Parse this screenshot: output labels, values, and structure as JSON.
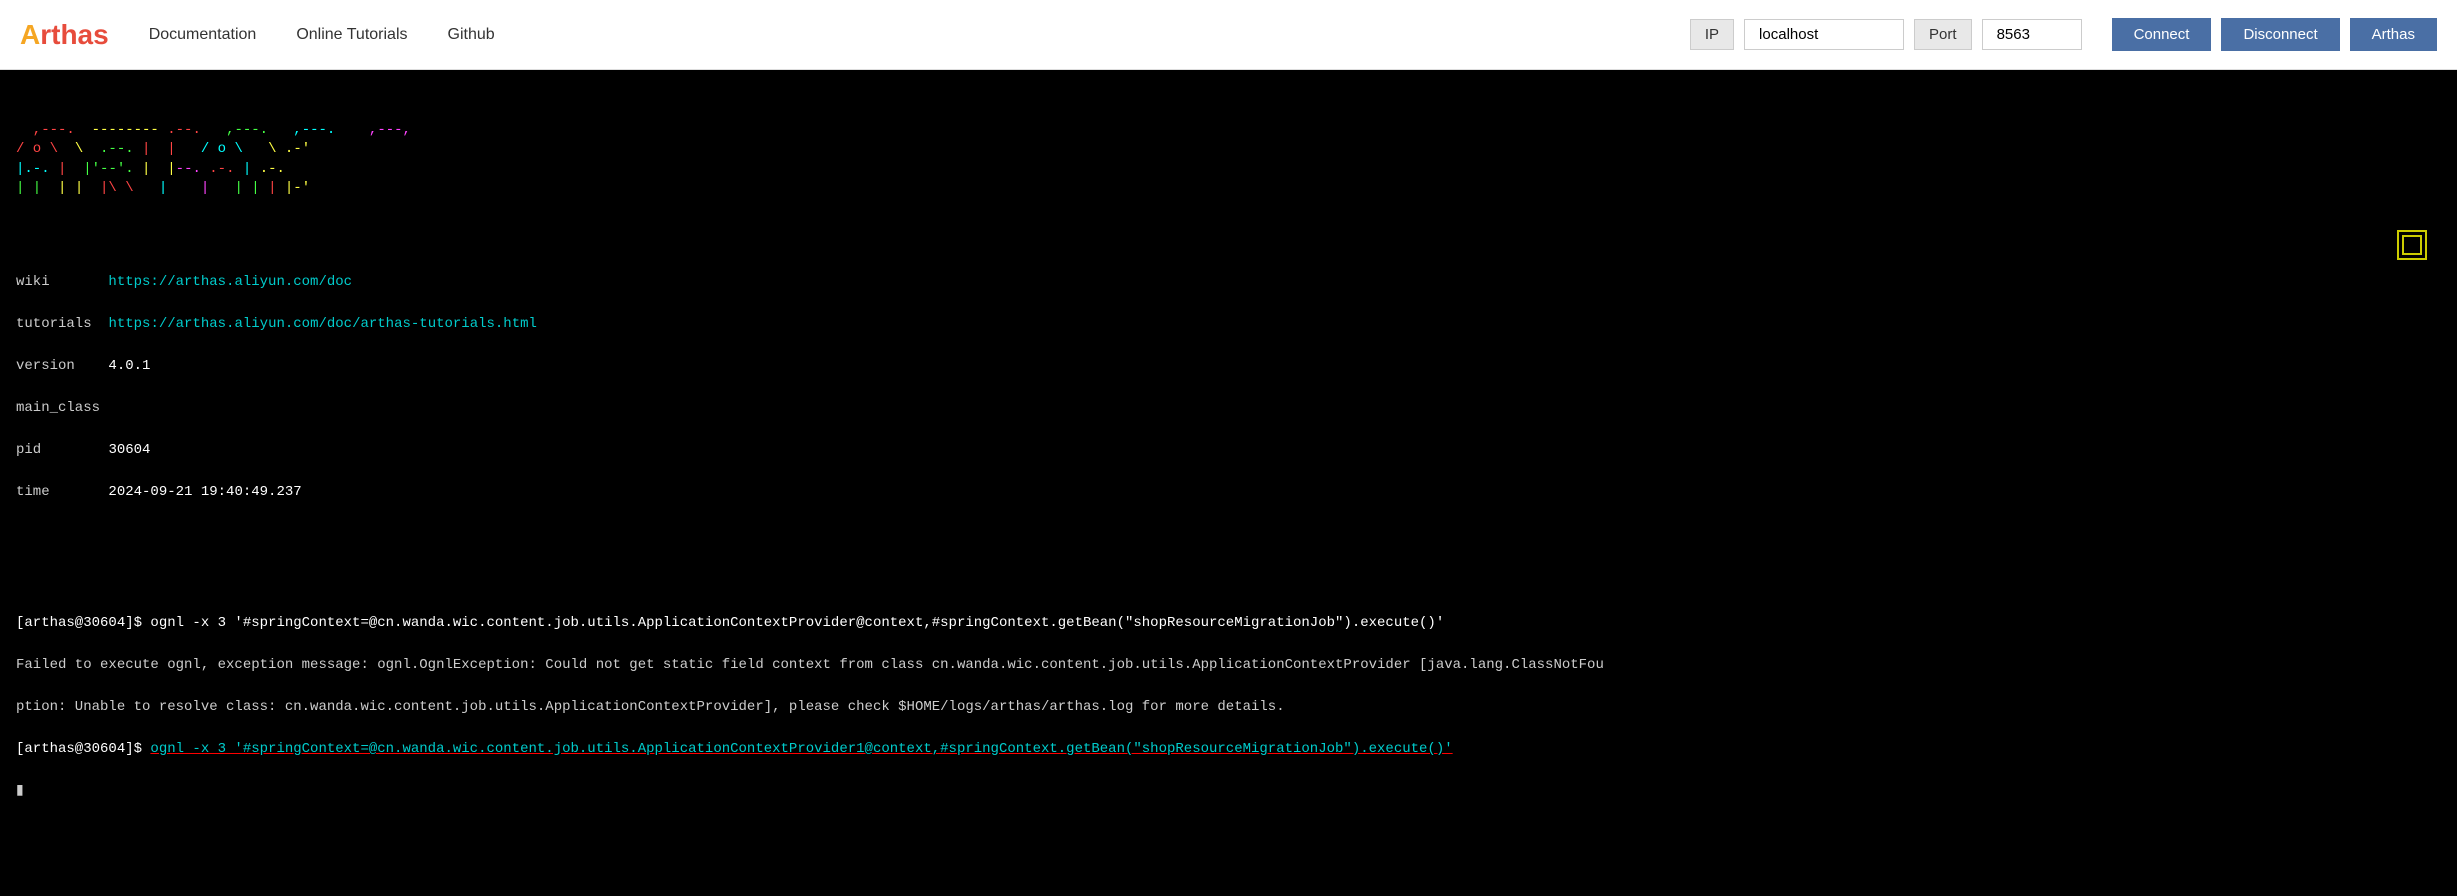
{
  "header": {
    "logo": "Arthas",
    "logo_a": "A",
    "logo_rthas": "rthas",
    "nav": [
      {
        "label": "Documentation",
        "id": "doc"
      },
      {
        "label": "Online Tutorials",
        "id": "tutorials"
      },
      {
        "label": "Github",
        "id": "github"
      }
    ],
    "ip_label": "IP",
    "ip_value": "localhost",
    "port_label": "Port",
    "port_value": "8563",
    "btn_connect": "Connect",
    "btn_disconnect": "Disconnect",
    "btn_arthas": "Arthas"
  },
  "terminal": {
    "info": {
      "wiki_key": "wiki",
      "wiki_val": "https://arthas.aliyun.com/doc",
      "tutorials_key": "tutorials",
      "tutorials_val": "https://arthas.aliyun.com/doc/arthas-tutorials.html",
      "version_key": "version",
      "version_val": "4.0.1",
      "main_class_key": "main_class",
      "pid_key": "pid",
      "pid_val": "30604",
      "time_key": "time",
      "time_val": "2024-09-21 19:40:49.237"
    },
    "lines": [
      "[arthas@30604]$ ognl -x 3 '#springContext=@cn.wanda.wic.content.job.utils.ApplicationContextProvider@context,#springContext.getBean(\"shopResourceMigrationJob\").execute()'",
      "Failed to execute ognl, exception message: ognl.OgnlException: Could not get static field context from class cn.wanda.wic.content.job.utils.ApplicationContextProvider [java.lang.ClassNotFou",
      "ption: Unable to resolve class: cn.wanda.wic.content.job.utils.ApplicationContextProvider], please check $HOME/logs/arthas/arthas.log for more details.",
      "[arthas@30604]$ ognl -x 3 '#springContext=@cn.wanda.wic.content.job.utils.ApplicationContextProvider1@context,#springContext.getBean(\"shopResourceMigrationJob\").execute()'"
    ]
  }
}
